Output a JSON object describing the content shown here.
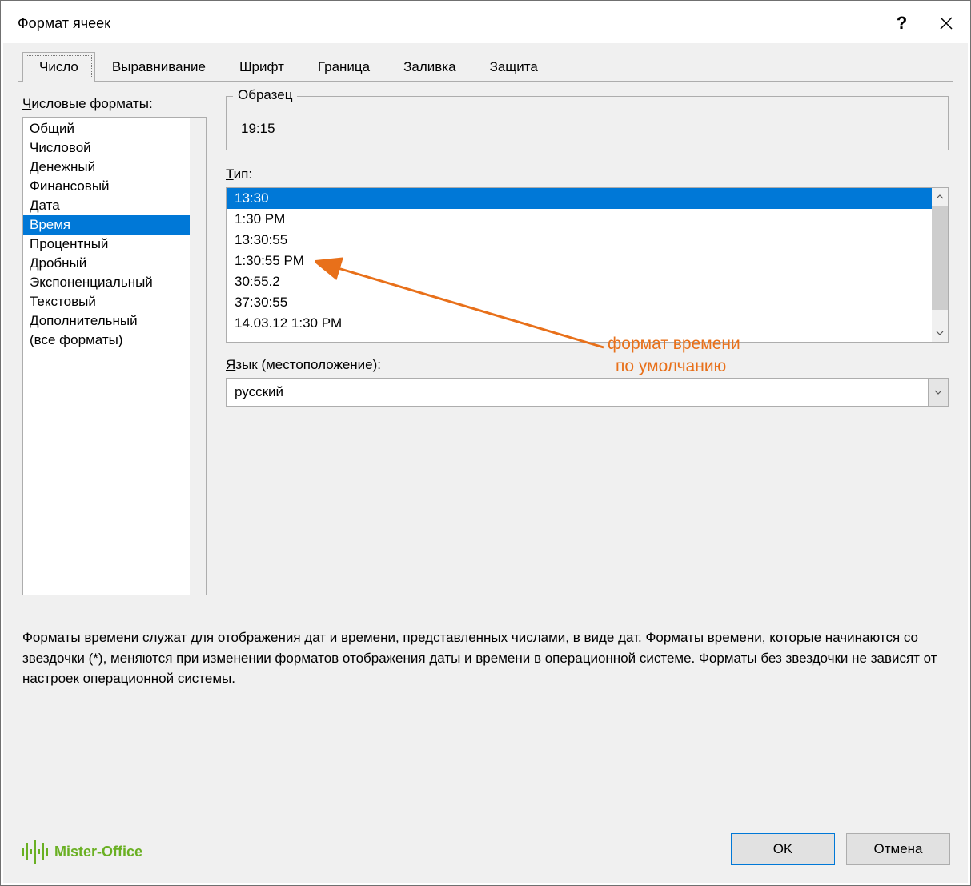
{
  "dialog": {
    "title": "Формат ячеек"
  },
  "tabs": [
    "Число",
    "Выравнивание",
    "Шрифт",
    "Граница",
    "Заливка",
    "Защита"
  ],
  "active_tab": 0,
  "categories_label": "Числовые форматы:",
  "categories": [
    "Общий",
    "Числовой",
    "Денежный",
    "Финансовый",
    "Дата",
    "Время",
    "Процентный",
    "Дробный",
    "Экспоненциальный",
    "Текстовый",
    "Дополнительный",
    "(все форматы)"
  ],
  "selected_category_index": 5,
  "sample": {
    "label": "Образец",
    "value": "19:15"
  },
  "type_label": "Тип:",
  "types": [
    "13:30",
    "1:30 PM",
    "13:30:55",
    "1:30:55 PM",
    "30:55.2",
    "37:30:55",
    "14.03.12 1:30 PM"
  ],
  "selected_type_index": 0,
  "locale_label": "Язык (местоположение):",
  "locale_value": "русский",
  "description": "Форматы времени служат для отображения дат и времени, представленных числами, в виде дат. Форматы времени, которые начинаются со звездочки (*), меняются при изменении форматов отображения даты и времени в операционной системе. Форматы без звездочки не зависят от настроек операционной системы.",
  "buttons": {
    "ok": "OK",
    "cancel": "Отмена"
  },
  "logo": "Mister-Office",
  "annotation": {
    "line1": "формат времени",
    "line2": "по умолчанию"
  }
}
